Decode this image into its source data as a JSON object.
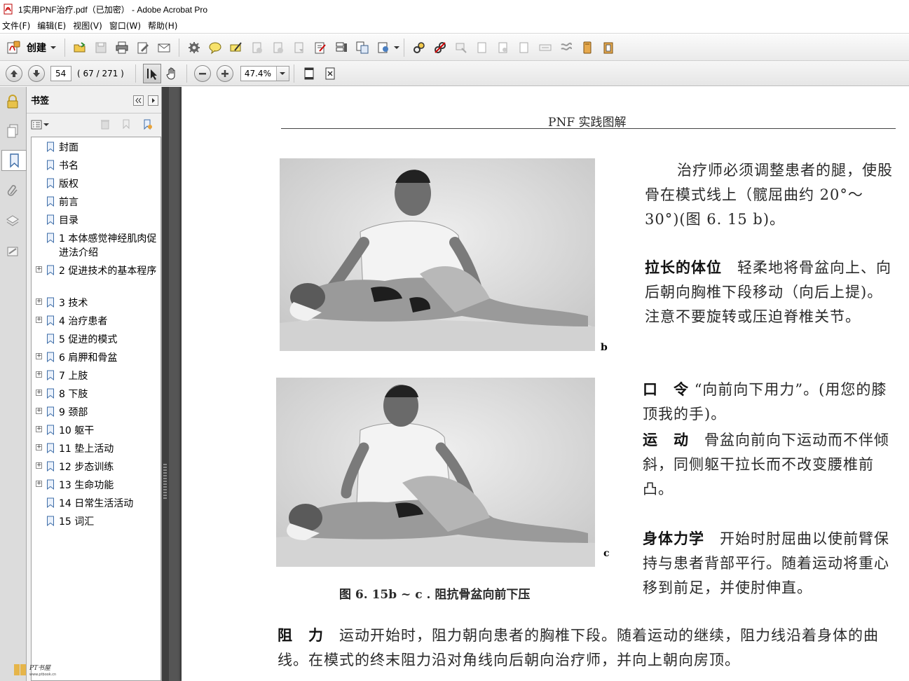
{
  "window": {
    "title": "1实用PNF治疗.pdf（已加密） - Adobe Acrobat Pro"
  },
  "menu": [
    "文件(F)",
    "编辑(E)",
    "视图(V)",
    "窗口(W)",
    "帮助(H)"
  ],
  "toolbar": {
    "create_label": "创建",
    "page_number": "54",
    "page_count": "( 67 / 271 )",
    "zoom": "47.4%"
  },
  "bookmarks": {
    "title": "书签",
    "items": [
      {
        "label": "封面",
        "expandable": false
      },
      {
        "label": "书名",
        "expandable": false
      },
      {
        "label": "版权",
        "expandable": false
      },
      {
        "label": "前言",
        "expandable": false
      },
      {
        "label": "目录",
        "expandable": false
      },
      {
        "label": "1 本体感觉神经肌肉促进法介绍",
        "expandable": false
      },
      {
        "label": "2 促进技术的基本程序",
        "expandable": true
      },
      {
        "label": "3 技术",
        "expandable": true
      },
      {
        "label": "4 治疗患者",
        "expandable": true
      },
      {
        "label": "5 促进的模式",
        "expandable": false
      },
      {
        "label": "6 肩胛和骨盆",
        "expandable": true
      },
      {
        "label": "7 上肢",
        "expandable": true
      },
      {
        "label": "8 下肢",
        "expandable": true
      },
      {
        "label": "9 颈部",
        "expandable": true
      },
      {
        "label": "10 躯干",
        "expandable": true
      },
      {
        "label": "11 垫上活动",
        "expandable": true
      },
      {
        "label": "12 步态训练",
        "expandable": true
      },
      {
        "label": "13 生命功能",
        "expandable": true
      },
      {
        "label": "14 日常生活活动",
        "expandable": false
      },
      {
        "label": "15 词汇",
        "expandable": false
      }
    ]
  },
  "document": {
    "running_head": "PNF 实践图解",
    "fig_b": "b",
    "fig_c": "c",
    "caption": "图 6. 15b ~ c . 阻抗骨盆向前下压",
    "p1": "治疗师必须调整患者的腿，使股骨在模式线上（髋屈曲约 20°～30°)(图 6. 15 b)。",
    "p2_head": "拉长的体位",
    "p2": "轻柔地将骨盆向上、向后朝向胸椎下段移动（向后上提)。注意不要旋转或压迫脊椎关节。",
    "p3_head": "口　令",
    "p3": "“向前向下用力”。(用您的膝顶我的手)。",
    "p4_head": "运　动",
    "p4": "骨盆向前向下运动而不伴倾斜，同侧躯干拉长而不改变腰椎前凸。",
    "p5_head": "身体力学",
    "p5": "开始时肘屈曲以使前臂保持与患者背部平行。随着运动将重心移到前足，并使肘伸直。",
    "p6_head": "阻　力",
    "p6": "运动开始时，阻力朝向患者的胸椎下段。随着运动的继续，阻力线沿着身体的曲线。在模式的终末阻力沿对角线向后朝向治疗师，并向上朝向房顶。"
  },
  "watermark": {
    "logo_text": "PT书屋",
    "url": "www.ptbook.cn"
  }
}
